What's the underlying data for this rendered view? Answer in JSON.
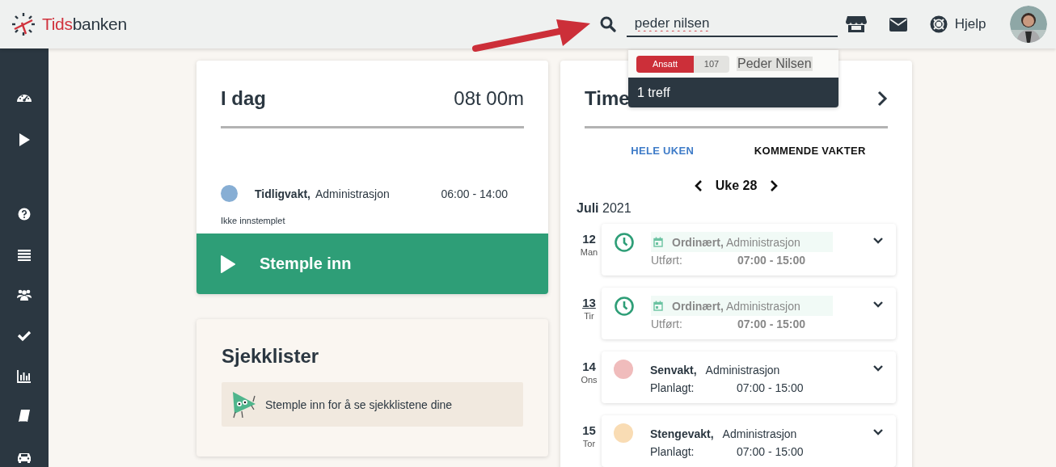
{
  "header": {
    "logo": {
      "part_1": "Tids",
      "part_2": "banken"
    },
    "search": {
      "value": "peder nilsen"
    },
    "help": "Hjelp"
  },
  "search_results": {
    "items": [
      {
        "tag": "Ansatt",
        "number": "107",
        "name": "Peder Nilsen",
        "selected": true
      }
    ],
    "count": "1 treff"
  },
  "today_card": {
    "title": "I dag",
    "total": "08t 00m",
    "shift": {
      "name": "Tidligvakt,",
      "department": "Administrasjon",
      "time": "06:00 - 14:00",
      "color": "#87aed4"
    },
    "status": "Ikke innstemplet",
    "button": "Stemple inn"
  },
  "checklist_card": {
    "title": "Sjekklister",
    "message": "Stemple inn for å se sjekklistene dine"
  },
  "timeline_card": {
    "title": "Time",
    "tabs": [
      {
        "label": "HELE UKEN",
        "selected": true
      },
      {
        "label": "KOMMENDE VAKTER",
        "selected": false
      }
    ],
    "week": "Uke 28",
    "month": "Juli",
    "year": "2021",
    "days": [
      {
        "date": "12",
        "weekday": "Man",
        "today": false,
        "kind": "done",
        "shift": "Ordinært,",
        "department": "Administrasjon",
        "label": "Utført:",
        "time": "07:00 - 15:00"
      },
      {
        "date": "13",
        "weekday": "Tir",
        "today": true,
        "kind": "done",
        "shift": "Ordinært,",
        "department": "Administrasjon",
        "label": "Utført:",
        "time": "07:00 - 15:00"
      },
      {
        "date": "14",
        "weekday": "Ons",
        "today": false,
        "kind": "planned",
        "color": "#f0bcbc",
        "shift": "Senvakt,",
        "department": "Administrasjon",
        "label": "Planlagt:",
        "time": "07:00 - 15:00"
      },
      {
        "date": "15",
        "weekday": "Tor",
        "today": false,
        "kind": "planned",
        "color": "#f9dcb4",
        "shift": "Stengevakt,",
        "department": "Administrasjon",
        "label": "Planlagt:",
        "time": "07:00 - 15:00"
      }
    ]
  }
}
